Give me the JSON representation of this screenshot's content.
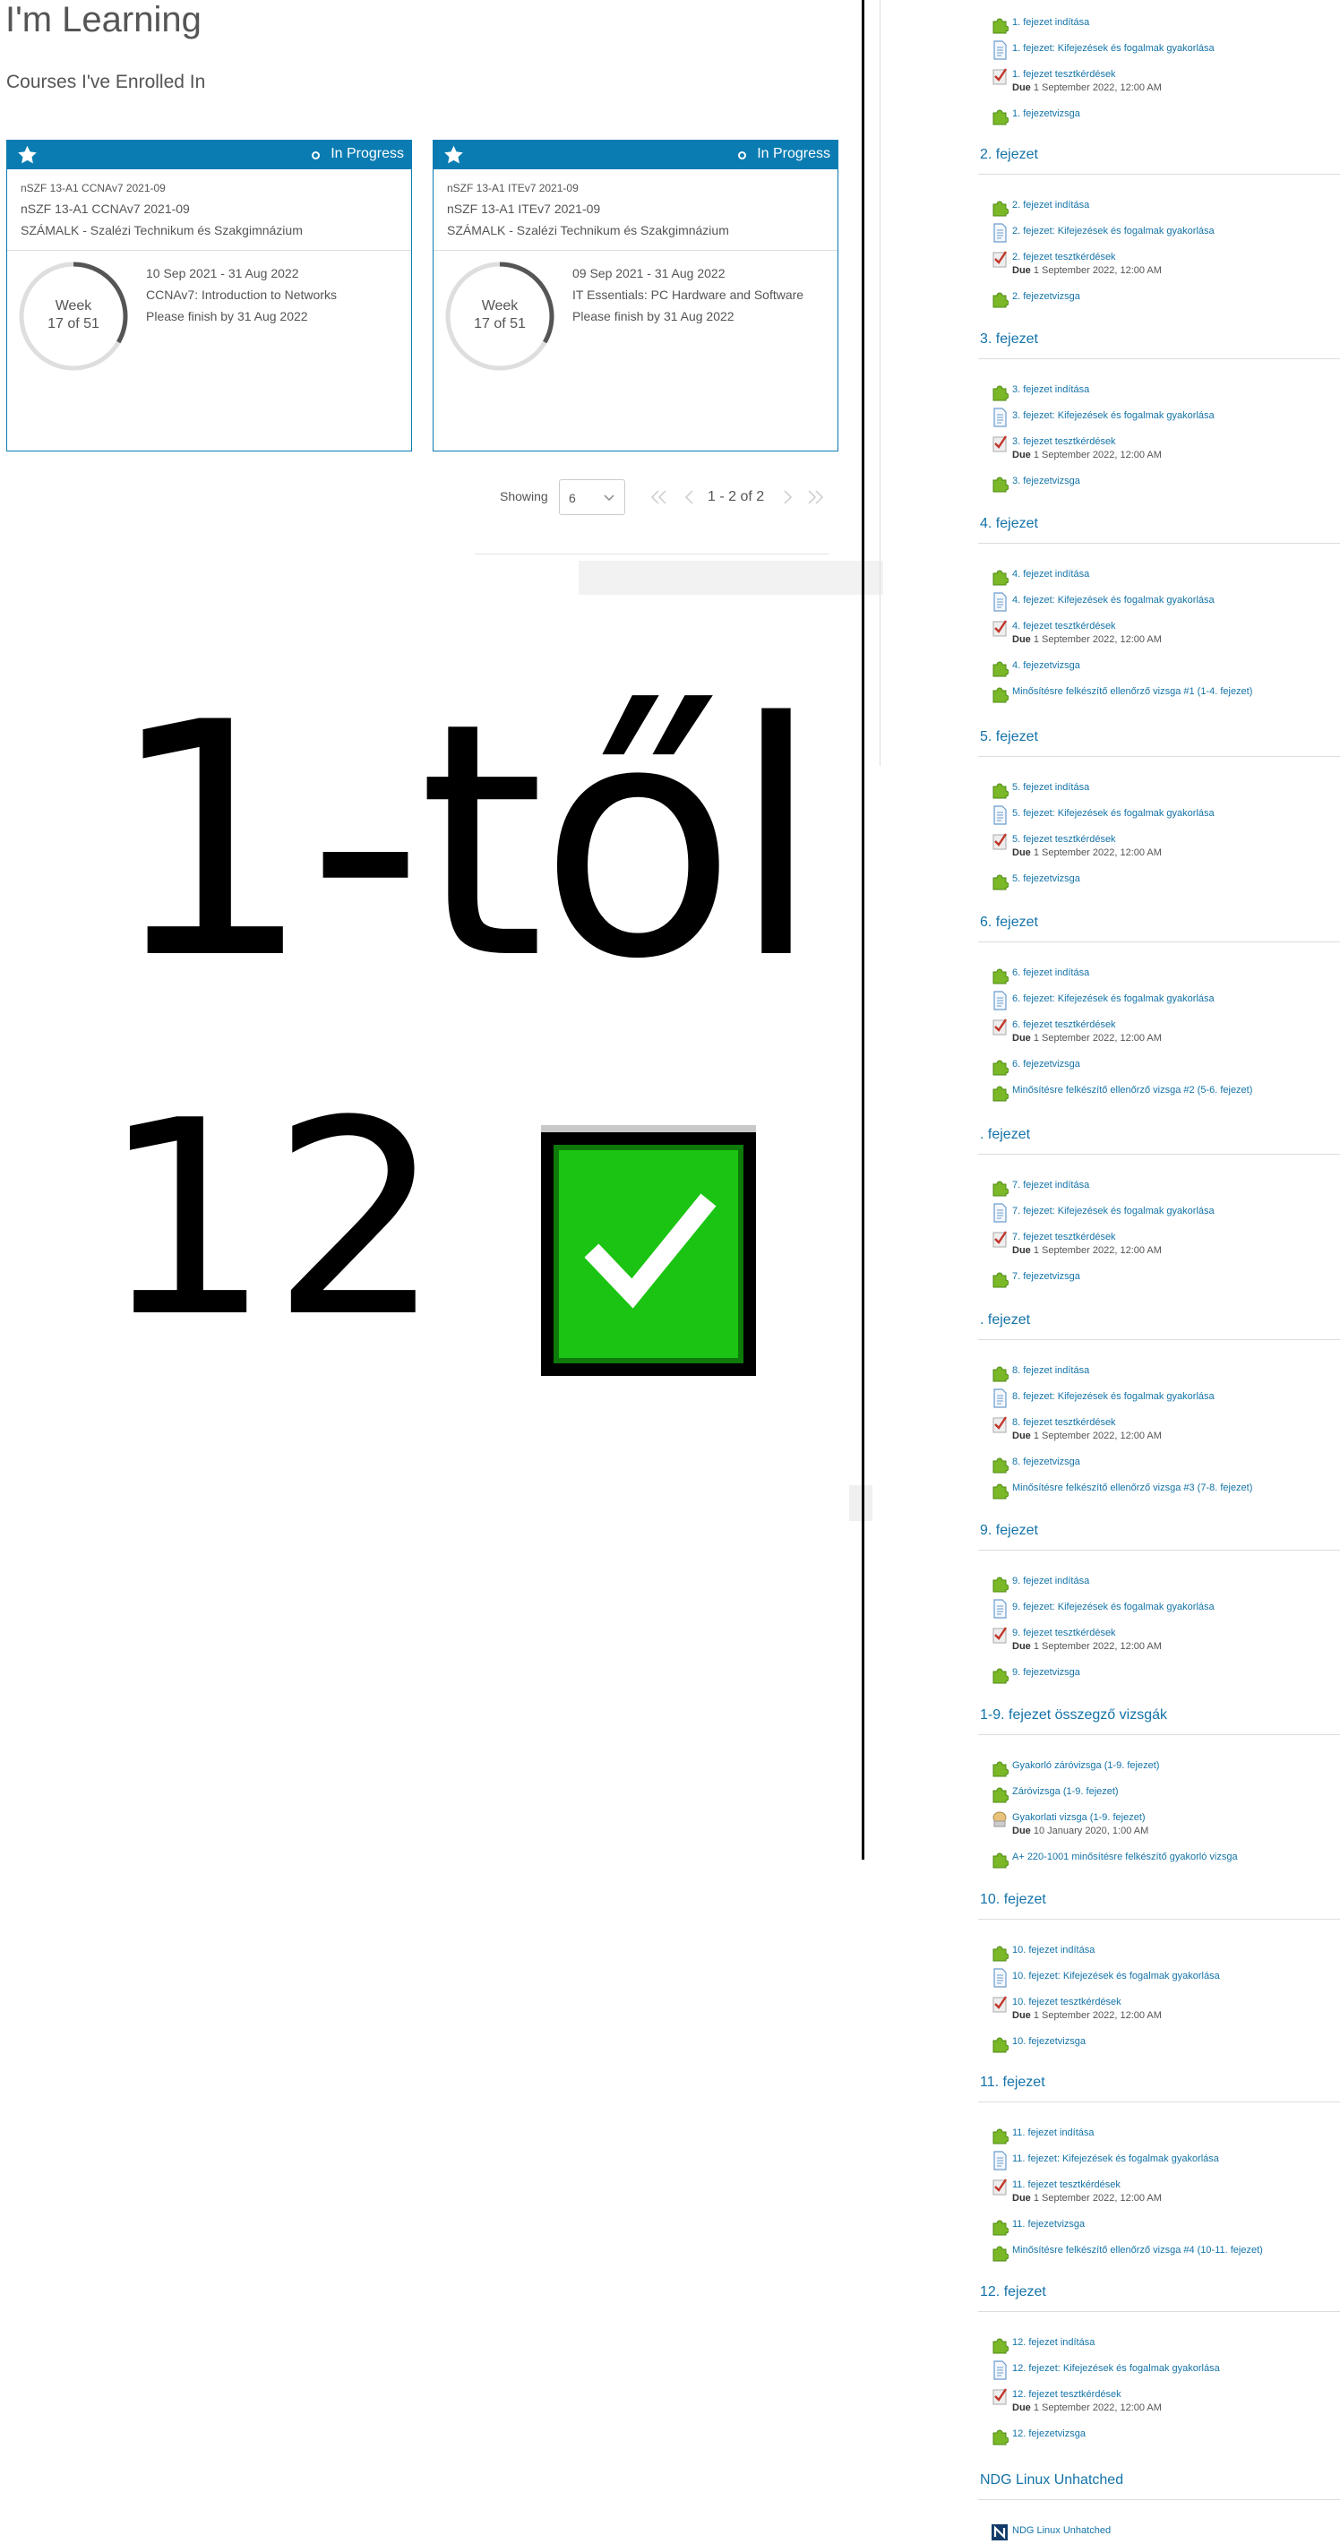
{
  "learning": {
    "title": "I'm Learning",
    "subtitle": "Courses I've Enrolled In",
    "cards": [
      {
        "status": "In Progress",
        "code": "nSZF 13-A1 CCNAv7 2021-09",
        "name": "nSZF 13-A1 CCNAv7 2021-09",
        "school": "SZÁMALK - Szalézi Technikum és Szakgimnázium",
        "week_label": "Week",
        "week_of": "17 of 51",
        "progress": 0.333,
        "dates": "10 Sep 2021 - 31 Aug 2022",
        "course": "CCNAv7: Introduction to Networks",
        "finish": "Please finish by 31 Aug 2022"
      },
      {
        "status": "In Progress",
        "code": "nSZF 13-A1 ITEv7 2021-09",
        "name": "nSZF 13-A1 ITEv7 2021-09",
        "school": "SZÁMALK - Szalézi Technikum és Szakgimnázium",
        "week_label": "Week",
        "week_of": "17 of 51",
        "progress": 0.333,
        "dates": "09 Sep 2021 - 31 Aug 2022",
        "course": "IT Essentials: PC Hardware and Software",
        "finish": "Please finish by 31 Aug 2022"
      }
    ],
    "pager": {
      "showing_label": "Showing",
      "page_size": "6",
      "range": "1 - 2 of 2"
    }
  },
  "overlay": {
    "line1": "1-től",
    "line2": "12"
  },
  "colors": {
    "accent": "#0a7cb2",
    "link": "#1473a8",
    "check_green": "#1bc412"
  },
  "modules": {
    "due_label": "Due",
    "chapters": [
      {
        "title": "",
        "items": [
          {
            "icon": "puzzle",
            "label": "1. fejezet indítása"
          },
          {
            "icon": "page",
            "label": "1. fejezet: Kifejezések és fogalmak gyakorlása"
          },
          {
            "icon": "quiz",
            "label": "1. fejezet tesztkérdések",
            "due": "1 September 2022, 12:00 AM"
          },
          {
            "icon": "puzzle",
            "label": "1. fejezetvizsga"
          }
        ]
      },
      {
        "title": "2. fejezet",
        "items": [
          {
            "icon": "puzzle",
            "label": "2. fejezet indítása"
          },
          {
            "icon": "page",
            "label": "2. fejezet: Kifejezések és fogalmak gyakorlása"
          },
          {
            "icon": "quiz",
            "label": "2. fejezet tesztkérdések",
            "due": "1 September 2022, 12:00 AM"
          },
          {
            "icon": "puzzle",
            "label": "2. fejezetvizsga"
          }
        ]
      },
      {
        "title": "3. fejezet",
        "items": [
          {
            "icon": "puzzle",
            "label": "3. fejezet indítása"
          },
          {
            "icon": "page",
            "label": "3. fejezet: Kifejezések és fogalmak gyakorlása"
          },
          {
            "icon": "quiz",
            "label": "3. fejezet tesztkérdések",
            "due": "1 September 2022, 12:00 AM"
          },
          {
            "icon": "puzzle",
            "label": "3. fejezetvizsga"
          }
        ]
      },
      {
        "title": "4. fejezet",
        "items": [
          {
            "icon": "puzzle",
            "label": "4. fejezet indítása"
          },
          {
            "icon": "page",
            "label": "4. fejezet: Kifejezések és fogalmak gyakorlása"
          },
          {
            "icon": "quiz",
            "label": "4. fejezet tesztkérdések",
            "due": "1 September 2022, 12:00 AM"
          },
          {
            "icon": "puzzle",
            "label": "4. fejezetvizsga"
          },
          {
            "icon": "puzzle",
            "label": "Minősítésre felkészítő ellenőrző vizsga #1 (1-4. fejezet)"
          }
        ]
      },
      {
        "title": "5. fejezet",
        "items": [
          {
            "icon": "puzzle",
            "label": "5. fejezet indítása"
          },
          {
            "icon": "page",
            "label": "5. fejezet: Kifejezések és fogalmak gyakorlása"
          },
          {
            "icon": "quiz",
            "label": "5. fejezet tesztkérdések",
            "due": "1 September 2022, 12:00 AM"
          },
          {
            "icon": "puzzle",
            "label": "5. fejezetvizsga"
          }
        ]
      },
      {
        "title": "6. fejezet",
        "items": [
          {
            "icon": "puzzle",
            "label": "6. fejezet indítása"
          },
          {
            "icon": "page",
            "label": "6. fejezet: Kifejezések és fogalmak gyakorlása"
          },
          {
            "icon": "quiz",
            "label": "6. fejezet tesztkérdések",
            "due": "1 September 2022, 12:00 AM"
          },
          {
            "icon": "puzzle",
            "label": "6. fejezetvizsga"
          },
          {
            "icon": "puzzle",
            "label": "Minősítésre felkészítő ellenőrző vizsga #2 (5-6. fejezet)"
          }
        ]
      },
      {
        "title": ". fejezet",
        "items": [
          {
            "icon": "puzzle",
            "label": "7. fejezet indítása"
          },
          {
            "icon": "page",
            "label": "7. fejezet: Kifejezések és fogalmak gyakorlása"
          },
          {
            "icon": "quiz",
            "label": "7. fejezet tesztkérdések",
            "due": "1 September 2022, 12:00 AM"
          },
          {
            "icon": "puzzle",
            "label": "7. fejezetvizsga"
          }
        ]
      },
      {
        "title": ". fejezet",
        "items": [
          {
            "icon": "puzzle",
            "label": "8. fejezet indítása"
          },
          {
            "icon": "page",
            "label": "8. fejezet: Kifejezések és fogalmak gyakorlása"
          },
          {
            "icon": "quiz",
            "label": "8. fejezet tesztkérdések",
            "due": "1 September 2022, 12:00 AM"
          },
          {
            "icon": "puzzle",
            "label": "8. fejezetvizsga"
          },
          {
            "icon": "puzzle",
            "label": "Minősítésre felkészítő ellenőrző vizsga #3 (7-8. fejezet)"
          }
        ]
      },
      {
        "title": "9. fejezet",
        "items": [
          {
            "icon": "puzzle",
            "label": "9. fejezet indítása"
          },
          {
            "icon": "page",
            "label": "9. fejezet: Kifejezések és fogalmak gyakorlása"
          },
          {
            "icon": "quiz",
            "label": "9. fejezet tesztkérdések",
            "due": "1 September 2022, 12:00 AM"
          },
          {
            "icon": "puzzle",
            "label": "9. fejezetvizsga"
          }
        ]
      },
      {
        "title": "1-9. fejezet összegző vizsgák",
        "items": [
          {
            "icon": "puzzle",
            "label": "Gyakorló záróvizsga (1-9. fejezet)"
          },
          {
            "icon": "puzzle",
            "label": "Záróvizsga (1-9. fejezet)"
          },
          {
            "icon": "lab",
            "label": "Gyakorlati vizsga (1-9. fejezet)",
            "due": "10 January 2020, 1:00 AM"
          },
          {
            "icon": "puzzle",
            "label": "A+ 220-1001 minősítésre felkészítő gyakorló vizsga"
          }
        ]
      },
      {
        "title": "10. fejezet",
        "items": [
          {
            "icon": "puzzle",
            "label": "10. fejezet indítása"
          },
          {
            "icon": "page",
            "label": "10. fejezet: Kifejezések és fogalmak gyakorlása"
          },
          {
            "icon": "quiz",
            "label": "10. fejezet tesztkérdések",
            "due": "1 September 2022, 12:00 AM"
          },
          {
            "icon": "puzzle",
            "label": "10. fejezetvizsga"
          }
        ]
      },
      {
        "title": "11. fejezet",
        "items": [
          {
            "icon": "puzzle",
            "label": "11. fejezet indítása"
          },
          {
            "icon": "page",
            "label": "11. fejezet: Kifejezések és fogalmak gyakorlása"
          },
          {
            "icon": "quiz",
            "label": "11. fejezet tesztkérdések",
            "due": "1 September 2022, 12:00 AM"
          },
          {
            "icon": "puzzle",
            "label": "11. fejezetvizsga"
          },
          {
            "icon": "puzzle",
            "label": "Minősítésre felkészítő ellenőrző vizsga #4 (10-11. fejezet)"
          }
        ]
      },
      {
        "title": "12. fejezet",
        "items": [
          {
            "icon": "puzzle",
            "label": "12. fejezet indítása"
          },
          {
            "icon": "page",
            "label": "12. fejezet: Kifejezések és fogalmak gyakorlása"
          },
          {
            "icon": "quiz",
            "label": "12. fejezet tesztkérdések",
            "due": "1 September 2022, 12:00 AM"
          },
          {
            "icon": "puzzle",
            "label": "12. fejezetvizsga"
          }
        ]
      },
      {
        "title": "NDG Linux Unhatched",
        "items": [
          {
            "icon": "ndg",
            "label": "NDG Linux Unhatched"
          }
        ]
      }
    ]
  }
}
